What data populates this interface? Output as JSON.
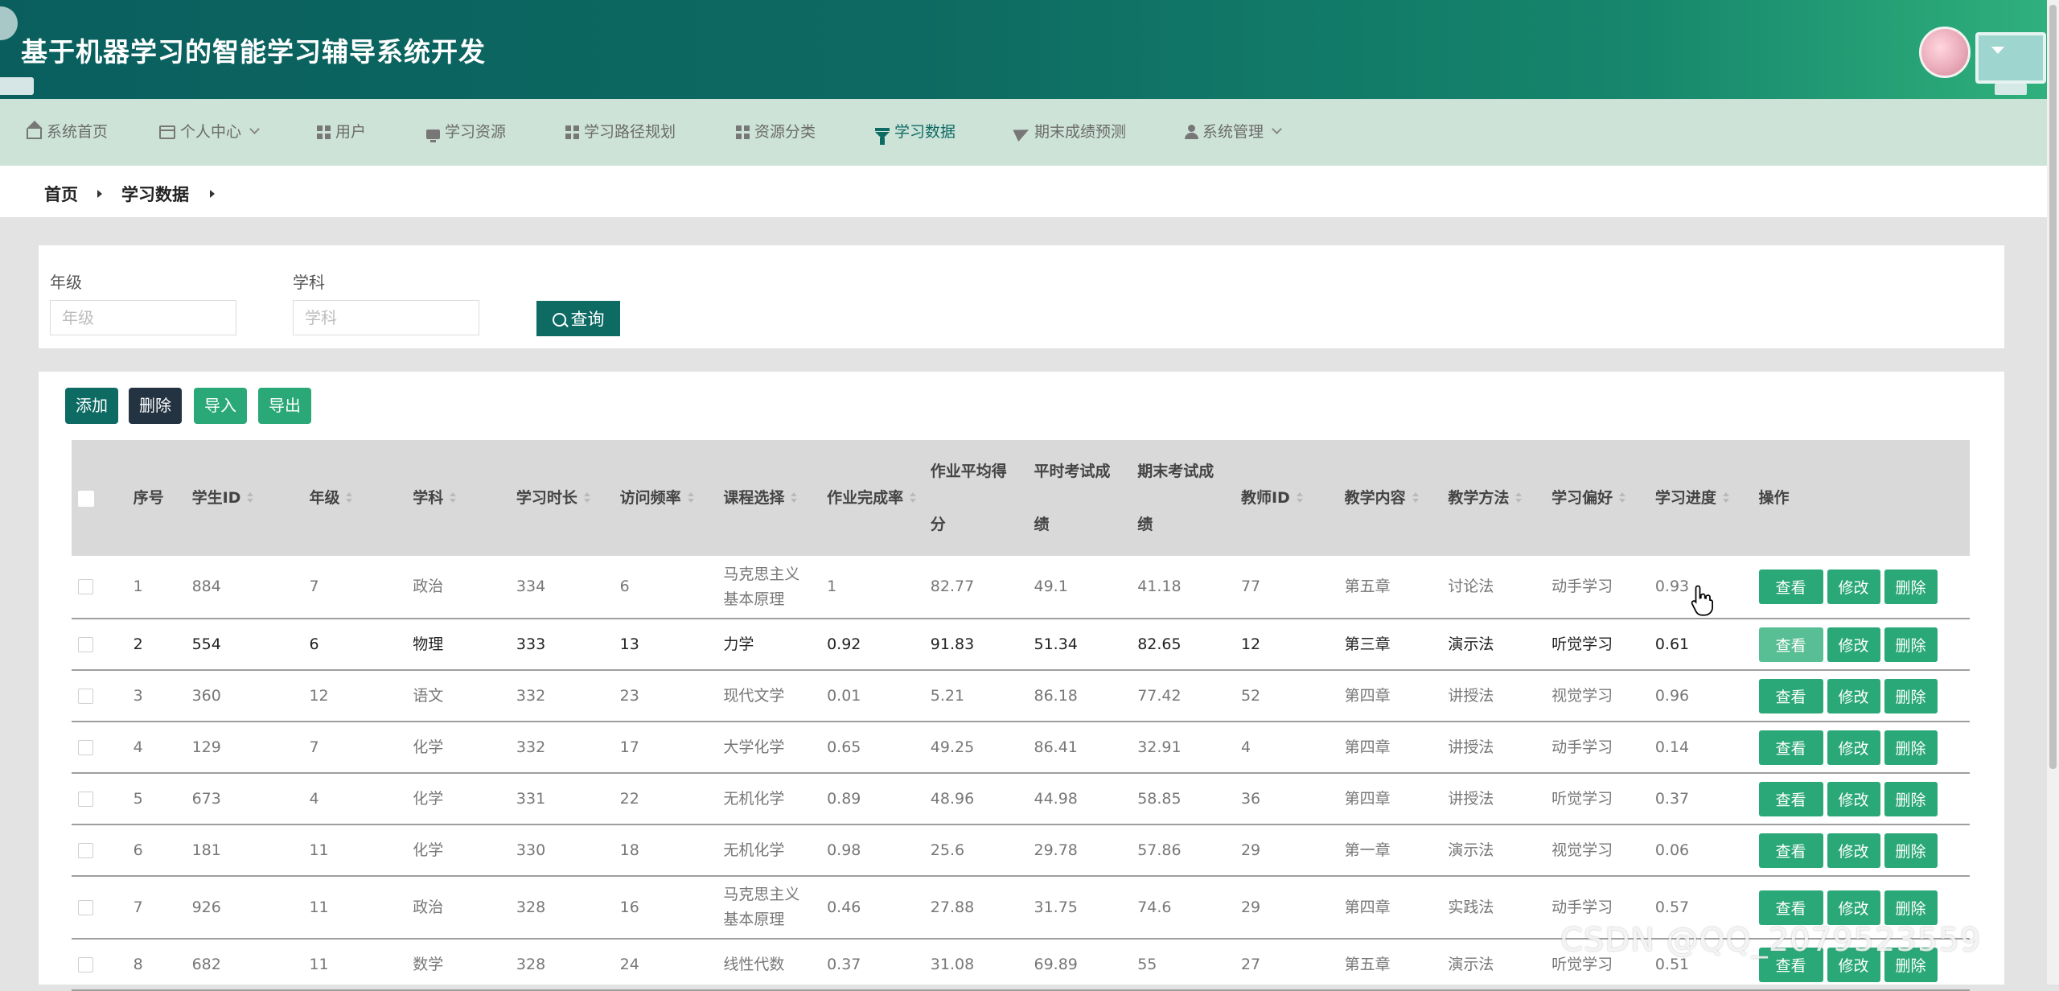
{
  "app": {
    "title": "基于机器学习的智能学习辅导系统开发"
  },
  "nav": [
    {
      "label": "系统首页",
      "icon": "home-icon"
    },
    {
      "label": "个人中心",
      "icon": "card-icon",
      "dropdown": true
    },
    {
      "label": "用户",
      "icon": "grid-icon"
    },
    {
      "label": "学习资源",
      "icon": "monitor-icon"
    },
    {
      "label": "学习路径规划",
      "icon": "grid-icon"
    },
    {
      "label": "资源分类",
      "icon": "grid-icon"
    },
    {
      "label": "学习数据",
      "icon": "filter-icon",
      "active": true
    },
    {
      "label": "期末成绩预测",
      "icon": "send-icon"
    },
    {
      "label": "系统管理",
      "icon": "user-icon",
      "dropdown": true
    }
  ],
  "breadcrumb": {
    "home": "首页",
    "current": "学习数据"
  },
  "search": {
    "grade_label": "年级",
    "grade_placeholder": "年级",
    "subject_label": "学科",
    "subject_placeholder": "学科",
    "query_label": "查询"
  },
  "toolbar": {
    "add": "添加",
    "delete": "删除",
    "import": "导入",
    "export": "导出"
  },
  "table": {
    "headers": [
      "序号",
      "学生ID",
      "年级",
      "学科",
      "学习时长",
      "访问频率",
      "课程选择",
      "作业完成率",
      "作业平均得分",
      "平时考试成绩",
      "期末考试成绩",
      "教师ID",
      "教学内容",
      "教学方法",
      "学习偏好",
      "学习进度",
      "操作"
    ],
    "rows": [
      [
        "1",
        "884",
        "7",
        "政治",
        "334",
        "6",
        "马克思主义基本原理",
        "1",
        "82.77",
        "49.1",
        "41.18",
        "77",
        "第五章",
        "讨论法",
        "动手学习",
        "0.93"
      ],
      [
        "2",
        "554",
        "6",
        "物理",
        "333",
        "13",
        "力学",
        "0.92",
        "91.83",
        "51.34",
        "82.65",
        "12",
        "第三章",
        "演示法",
        "听觉学习",
        "0.61"
      ],
      [
        "3",
        "360",
        "12",
        "语文",
        "332",
        "23",
        "现代文学",
        "0.01",
        "5.21",
        "86.18",
        "77.42",
        "52",
        "第四章",
        "讲授法",
        "视觉学习",
        "0.96"
      ],
      [
        "4",
        "129",
        "7",
        "化学",
        "332",
        "17",
        "大学化学",
        "0.65",
        "49.25",
        "86.41",
        "32.91",
        "4",
        "第四章",
        "讲授法",
        "动手学习",
        "0.14"
      ],
      [
        "5",
        "673",
        "4",
        "化学",
        "331",
        "22",
        "无机化学",
        "0.89",
        "48.96",
        "44.98",
        "58.85",
        "36",
        "第四章",
        "讲授法",
        "听觉学习",
        "0.37"
      ],
      [
        "6",
        "181",
        "11",
        "化学",
        "330",
        "18",
        "无机化学",
        "0.98",
        "25.6",
        "29.78",
        "57.86",
        "29",
        "第一章",
        "演示法",
        "视觉学习",
        "0.06"
      ],
      [
        "7",
        "926",
        "11",
        "政治",
        "328",
        "16",
        "马克思主义基本原理",
        "0.46",
        "27.88",
        "31.75",
        "74.6",
        "29",
        "第四章",
        "实践法",
        "动手学习",
        "0.57"
      ],
      [
        "8",
        "682",
        "11",
        "数学",
        "328",
        "24",
        "线性代数",
        "0.37",
        "31.08",
        "69.89",
        "55",
        "27",
        "第五章",
        "演示法",
        "听觉学习",
        "0.51"
      ]
    ],
    "ops": {
      "view": "查看",
      "edit": "修改",
      "del": "删除"
    }
  },
  "watermark": "CSDN @QQ_2079523559",
  "colors": {
    "header_start": "#0a5f5e",
    "header_end": "#2fb07c",
    "nav_bg": "#cde3d7",
    "primary_dark": "#0e6b64",
    "action_green": "#2aa878",
    "delete_dark": "#233342"
  }
}
